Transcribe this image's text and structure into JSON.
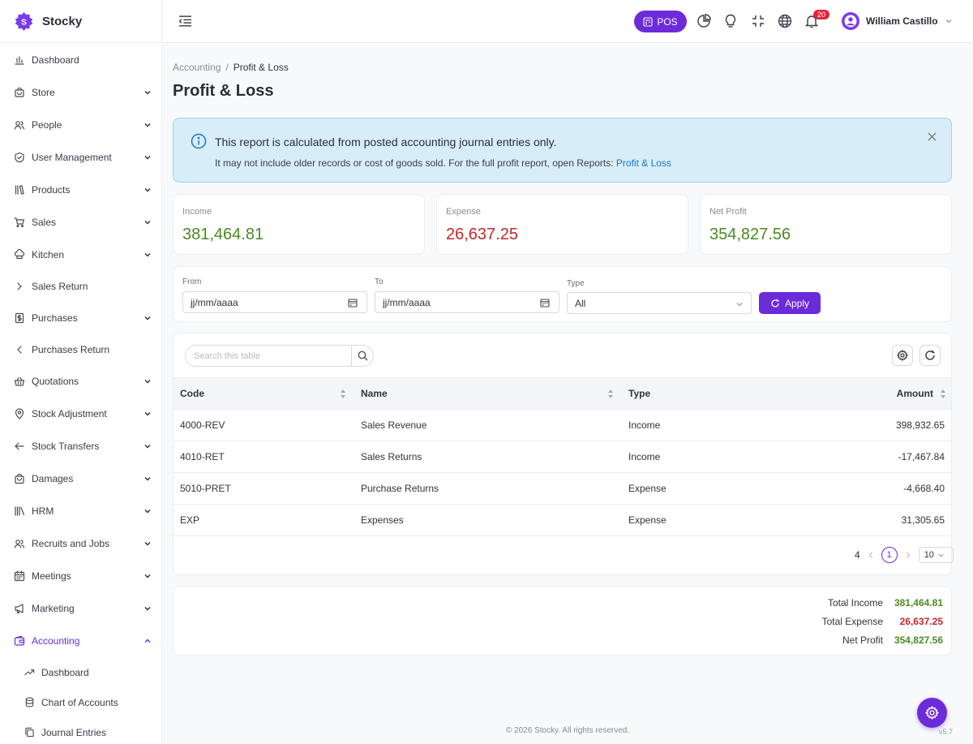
{
  "brand": {
    "name": "Stocky",
    "logo_letter": "S"
  },
  "sidebar": {
    "items": [
      {
        "label": "Dashboard",
        "icon": "bar-chart-icon",
        "chevron": "none"
      },
      {
        "label": "Store",
        "icon": "store-icon",
        "chevron": "down"
      },
      {
        "label": "People",
        "icon": "people-icon",
        "chevron": "down"
      },
      {
        "label": "User Management",
        "icon": "shield-icon",
        "chevron": "down"
      },
      {
        "label": "Products",
        "icon": "books-icon",
        "chevron": "down"
      },
      {
        "label": "Sales",
        "icon": "cart-icon",
        "chevron": "down"
      },
      {
        "label": "Kitchen",
        "icon": "chef-hat-icon",
        "chevron": "down"
      },
      {
        "label": "Sales Return",
        "icon": "chevron-right-icon",
        "chevron": "none"
      },
      {
        "label": "Purchases",
        "icon": "receipt-icon",
        "chevron": "down"
      },
      {
        "label": "Purchases Return",
        "icon": "chevron-left-icon",
        "chevron": "none"
      },
      {
        "label": "Quotations",
        "icon": "basket-icon",
        "chevron": "down"
      },
      {
        "label": "Stock Adjustment",
        "icon": "location-icon",
        "chevron": "down"
      },
      {
        "label": "Stock Transfers",
        "icon": "arrow-left-icon",
        "chevron": "down"
      },
      {
        "label": "Damages",
        "icon": "bag-icon",
        "chevron": "down"
      },
      {
        "label": "HRM",
        "icon": "library-icon",
        "chevron": "down"
      },
      {
        "label": "Recruits and Jobs",
        "icon": "people-icon",
        "chevron": "down"
      },
      {
        "label": "Meetings",
        "icon": "calendar-icon",
        "chevron": "down"
      },
      {
        "label": "Marketing",
        "icon": "megaphone-icon",
        "chevron": "down"
      },
      {
        "label": "Accounting",
        "icon": "wallet-icon",
        "chevron": "up"
      }
    ],
    "subitems": [
      {
        "label": "Dashboard",
        "icon": "trend-up-icon"
      },
      {
        "label": "Chart of Accounts",
        "icon": "database-icon"
      },
      {
        "label": "Journal Entries",
        "icon": "copy-icon"
      }
    ]
  },
  "header": {
    "pos_label": "POS",
    "notification_count": "20",
    "user_name": "William Castillo"
  },
  "breadcrumb": {
    "parent": "Accounting",
    "separator": "/",
    "current": "Profit & Loss"
  },
  "page_title": "Profit & Loss",
  "alert": {
    "title": "This report is calculated from posted accounting journal entries only.",
    "body": "It may not include older records or cost of goods sold. For the full profit report, open Reports:",
    "link": "Profit & Loss"
  },
  "stats": {
    "income": {
      "label": "Income",
      "value": "381,464.81"
    },
    "expense": {
      "label": "Expense",
      "value": "26,637.25"
    },
    "net": {
      "label": "Net Profit",
      "value": "354,827.56"
    }
  },
  "filters": {
    "from_label": "From",
    "from_placeholder": "jj/mm/aaaa",
    "to_label": "To",
    "to_placeholder": "jj/mm/aaaa",
    "type_label": "Type",
    "type_value": "All",
    "apply_label": "Apply"
  },
  "table": {
    "search_placeholder": "Search this table",
    "columns": [
      "Code",
      "Name",
      "Type",
      "Amount"
    ],
    "rows": [
      {
        "code": "4000-REV",
        "name": "Sales Revenue",
        "type": "Income",
        "amount": "398,932.65"
      },
      {
        "code": "4010-RET",
        "name": "Sales Returns",
        "type": "Income",
        "amount": "-17,467.84"
      },
      {
        "code": "5010-PRET",
        "name": "Purchase Returns",
        "type": "Expense",
        "amount": "-4,668.40"
      },
      {
        "code": "EXP",
        "name": "Expenses",
        "type": "Expense",
        "amount": "31,305.65"
      }
    ],
    "total_rows": "4",
    "current_page": "1",
    "page_size": "10"
  },
  "totals": {
    "income_label": "Total Income",
    "income_value": "381,464.81",
    "expense_label": "Total Expense",
    "expense_value": "26,637.25",
    "net_label": "Net Profit",
    "net_value": "354,827.56"
  },
  "footer": {
    "copyright": "© 2026 Stocky. All rights reserved.",
    "version": "v5.7"
  },
  "colors": {
    "accent": "#6c2bd9",
    "positive": "#4a8a22",
    "negative": "#c6262e",
    "info_bg": "#d7eef8"
  }
}
